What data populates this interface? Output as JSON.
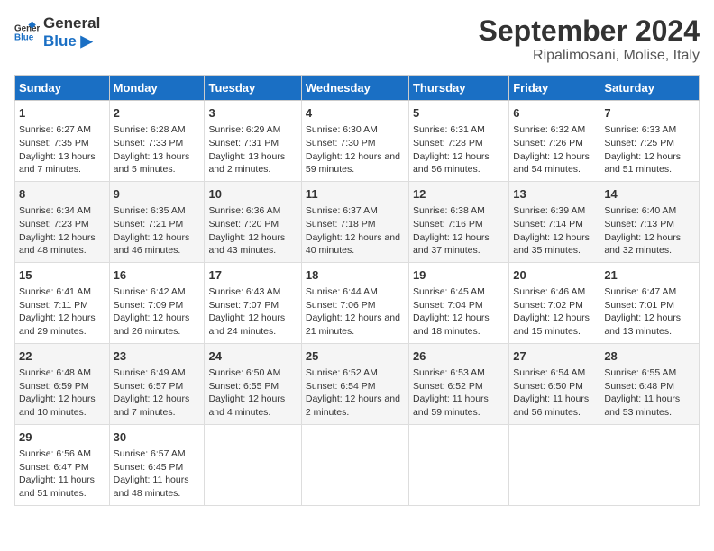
{
  "header": {
    "logo_line1": "General",
    "logo_line2": "Blue",
    "title": "September 2024",
    "subtitle": "Ripalimosani, Molise, Italy"
  },
  "columns": [
    "Sunday",
    "Monday",
    "Tuesday",
    "Wednesday",
    "Thursday",
    "Friday",
    "Saturday"
  ],
  "weeks": [
    [
      {
        "day": "1",
        "info": "Sunrise: 6:27 AM\nSunset: 7:35 PM\nDaylight: 13 hours and 7 minutes."
      },
      {
        "day": "2",
        "info": "Sunrise: 6:28 AM\nSunset: 7:33 PM\nDaylight: 13 hours and 5 minutes."
      },
      {
        "day": "3",
        "info": "Sunrise: 6:29 AM\nSunset: 7:31 PM\nDaylight: 13 hours and 2 minutes."
      },
      {
        "day": "4",
        "info": "Sunrise: 6:30 AM\nSunset: 7:30 PM\nDaylight: 12 hours and 59 minutes."
      },
      {
        "day": "5",
        "info": "Sunrise: 6:31 AM\nSunset: 7:28 PM\nDaylight: 12 hours and 56 minutes."
      },
      {
        "day": "6",
        "info": "Sunrise: 6:32 AM\nSunset: 7:26 PM\nDaylight: 12 hours and 54 minutes."
      },
      {
        "day": "7",
        "info": "Sunrise: 6:33 AM\nSunset: 7:25 PM\nDaylight: 12 hours and 51 minutes."
      }
    ],
    [
      {
        "day": "8",
        "info": "Sunrise: 6:34 AM\nSunset: 7:23 PM\nDaylight: 12 hours and 48 minutes."
      },
      {
        "day": "9",
        "info": "Sunrise: 6:35 AM\nSunset: 7:21 PM\nDaylight: 12 hours and 46 minutes."
      },
      {
        "day": "10",
        "info": "Sunrise: 6:36 AM\nSunset: 7:20 PM\nDaylight: 12 hours and 43 minutes."
      },
      {
        "day": "11",
        "info": "Sunrise: 6:37 AM\nSunset: 7:18 PM\nDaylight: 12 hours and 40 minutes."
      },
      {
        "day": "12",
        "info": "Sunrise: 6:38 AM\nSunset: 7:16 PM\nDaylight: 12 hours and 37 minutes."
      },
      {
        "day": "13",
        "info": "Sunrise: 6:39 AM\nSunset: 7:14 PM\nDaylight: 12 hours and 35 minutes."
      },
      {
        "day": "14",
        "info": "Sunrise: 6:40 AM\nSunset: 7:13 PM\nDaylight: 12 hours and 32 minutes."
      }
    ],
    [
      {
        "day": "15",
        "info": "Sunrise: 6:41 AM\nSunset: 7:11 PM\nDaylight: 12 hours and 29 minutes."
      },
      {
        "day": "16",
        "info": "Sunrise: 6:42 AM\nSunset: 7:09 PM\nDaylight: 12 hours and 26 minutes."
      },
      {
        "day": "17",
        "info": "Sunrise: 6:43 AM\nSunset: 7:07 PM\nDaylight: 12 hours and 24 minutes."
      },
      {
        "day": "18",
        "info": "Sunrise: 6:44 AM\nSunset: 7:06 PM\nDaylight: 12 hours and 21 minutes."
      },
      {
        "day": "19",
        "info": "Sunrise: 6:45 AM\nSunset: 7:04 PM\nDaylight: 12 hours and 18 minutes."
      },
      {
        "day": "20",
        "info": "Sunrise: 6:46 AM\nSunset: 7:02 PM\nDaylight: 12 hours and 15 minutes."
      },
      {
        "day": "21",
        "info": "Sunrise: 6:47 AM\nSunset: 7:01 PM\nDaylight: 12 hours and 13 minutes."
      }
    ],
    [
      {
        "day": "22",
        "info": "Sunrise: 6:48 AM\nSunset: 6:59 PM\nDaylight: 12 hours and 10 minutes."
      },
      {
        "day": "23",
        "info": "Sunrise: 6:49 AM\nSunset: 6:57 PM\nDaylight: 12 hours and 7 minutes."
      },
      {
        "day": "24",
        "info": "Sunrise: 6:50 AM\nSunset: 6:55 PM\nDaylight: 12 hours and 4 minutes."
      },
      {
        "day": "25",
        "info": "Sunrise: 6:52 AM\nSunset: 6:54 PM\nDaylight: 12 hours and 2 minutes."
      },
      {
        "day": "26",
        "info": "Sunrise: 6:53 AM\nSunset: 6:52 PM\nDaylight: 11 hours and 59 minutes."
      },
      {
        "day": "27",
        "info": "Sunrise: 6:54 AM\nSunset: 6:50 PM\nDaylight: 11 hours and 56 minutes."
      },
      {
        "day": "28",
        "info": "Sunrise: 6:55 AM\nSunset: 6:48 PM\nDaylight: 11 hours and 53 minutes."
      }
    ],
    [
      {
        "day": "29",
        "info": "Sunrise: 6:56 AM\nSunset: 6:47 PM\nDaylight: 11 hours and 51 minutes."
      },
      {
        "day": "30",
        "info": "Sunrise: 6:57 AM\nSunset: 6:45 PM\nDaylight: 11 hours and 48 minutes."
      },
      {
        "day": "",
        "info": ""
      },
      {
        "day": "",
        "info": ""
      },
      {
        "day": "",
        "info": ""
      },
      {
        "day": "",
        "info": ""
      },
      {
        "day": "",
        "info": ""
      }
    ]
  ]
}
